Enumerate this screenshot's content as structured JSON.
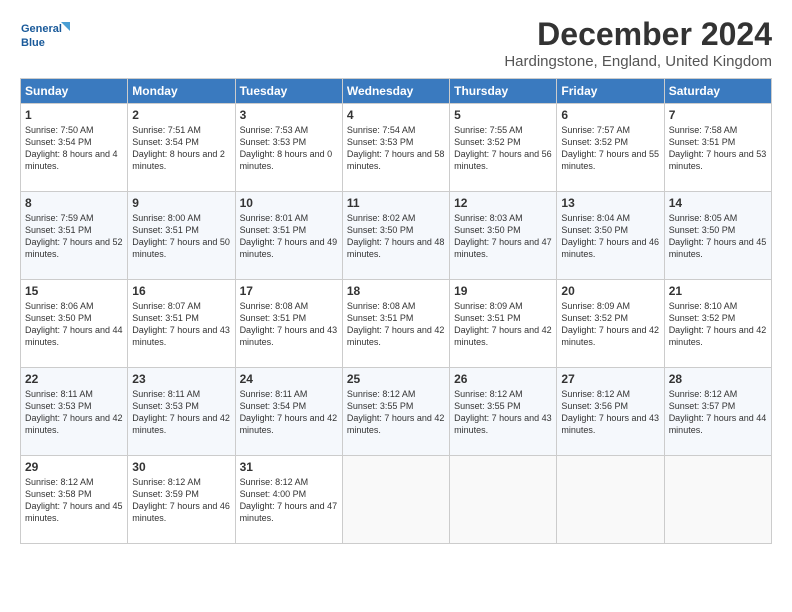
{
  "header": {
    "logo_line1": "General",
    "logo_line2": "Blue",
    "month": "December 2024",
    "location": "Hardingstone, England, United Kingdom"
  },
  "weekdays": [
    "Sunday",
    "Monday",
    "Tuesday",
    "Wednesday",
    "Thursday",
    "Friday",
    "Saturday"
  ],
  "weeks": [
    [
      {
        "day": "1",
        "sunrise": "7:50 AM",
        "sunset": "3:54 PM",
        "daylight": "8 hours and 4 minutes."
      },
      {
        "day": "2",
        "sunrise": "7:51 AM",
        "sunset": "3:54 PM",
        "daylight": "8 hours and 2 minutes."
      },
      {
        "day": "3",
        "sunrise": "7:53 AM",
        "sunset": "3:53 PM",
        "daylight": "8 hours and 0 minutes."
      },
      {
        "day": "4",
        "sunrise": "7:54 AM",
        "sunset": "3:53 PM",
        "daylight": "7 hours and 58 minutes."
      },
      {
        "day": "5",
        "sunrise": "7:55 AM",
        "sunset": "3:52 PM",
        "daylight": "7 hours and 56 minutes."
      },
      {
        "day": "6",
        "sunrise": "7:57 AM",
        "sunset": "3:52 PM",
        "daylight": "7 hours and 55 minutes."
      },
      {
        "day": "7",
        "sunrise": "7:58 AM",
        "sunset": "3:51 PM",
        "daylight": "7 hours and 53 minutes."
      }
    ],
    [
      {
        "day": "8",
        "sunrise": "7:59 AM",
        "sunset": "3:51 PM",
        "daylight": "7 hours and 52 minutes."
      },
      {
        "day": "9",
        "sunrise": "8:00 AM",
        "sunset": "3:51 PM",
        "daylight": "7 hours and 50 minutes."
      },
      {
        "day": "10",
        "sunrise": "8:01 AM",
        "sunset": "3:51 PM",
        "daylight": "7 hours and 49 minutes."
      },
      {
        "day": "11",
        "sunrise": "8:02 AM",
        "sunset": "3:50 PM",
        "daylight": "7 hours and 48 minutes."
      },
      {
        "day": "12",
        "sunrise": "8:03 AM",
        "sunset": "3:50 PM",
        "daylight": "7 hours and 47 minutes."
      },
      {
        "day": "13",
        "sunrise": "8:04 AM",
        "sunset": "3:50 PM",
        "daylight": "7 hours and 46 minutes."
      },
      {
        "day": "14",
        "sunrise": "8:05 AM",
        "sunset": "3:50 PM",
        "daylight": "7 hours and 45 minutes."
      }
    ],
    [
      {
        "day": "15",
        "sunrise": "8:06 AM",
        "sunset": "3:50 PM",
        "daylight": "7 hours and 44 minutes."
      },
      {
        "day": "16",
        "sunrise": "8:07 AM",
        "sunset": "3:51 PM",
        "daylight": "7 hours and 43 minutes."
      },
      {
        "day": "17",
        "sunrise": "8:08 AM",
        "sunset": "3:51 PM",
        "daylight": "7 hours and 43 minutes."
      },
      {
        "day": "18",
        "sunrise": "8:08 AM",
        "sunset": "3:51 PM",
        "daylight": "7 hours and 42 minutes."
      },
      {
        "day": "19",
        "sunrise": "8:09 AM",
        "sunset": "3:51 PM",
        "daylight": "7 hours and 42 minutes."
      },
      {
        "day": "20",
        "sunrise": "8:09 AM",
        "sunset": "3:52 PM",
        "daylight": "7 hours and 42 minutes."
      },
      {
        "day": "21",
        "sunrise": "8:10 AM",
        "sunset": "3:52 PM",
        "daylight": "7 hours and 42 minutes."
      }
    ],
    [
      {
        "day": "22",
        "sunrise": "8:11 AM",
        "sunset": "3:53 PM",
        "daylight": "7 hours and 42 minutes."
      },
      {
        "day": "23",
        "sunrise": "8:11 AM",
        "sunset": "3:53 PM",
        "daylight": "7 hours and 42 minutes."
      },
      {
        "day": "24",
        "sunrise": "8:11 AM",
        "sunset": "3:54 PM",
        "daylight": "7 hours and 42 minutes."
      },
      {
        "day": "25",
        "sunrise": "8:12 AM",
        "sunset": "3:55 PM",
        "daylight": "7 hours and 42 minutes."
      },
      {
        "day": "26",
        "sunrise": "8:12 AM",
        "sunset": "3:55 PM",
        "daylight": "7 hours and 43 minutes."
      },
      {
        "day": "27",
        "sunrise": "8:12 AM",
        "sunset": "3:56 PM",
        "daylight": "7 hours and 43 minutes."
      },
      {
        "day": "28",
        "sunrise": "8:12 AM",
        "sunset": "3:57 PM",
        "daylight": "7 hours and 44 minutes."
      }
    ],
    [
      {
        "day": "29",
        "sunrise": "8:12 AM",
        "sunset": "3:58 PM",
        "daylight": "7 hours and 45 minutes."
      },
      {
        "day": "30",
        "sunrise": "8:12 AM",
        "sunset": "3:59 PM",
        "daylight": "7 hours and 46 minutes."
      },
      {
        "day": "31",
        "sunrise": "8:12 AM",
        "sunset": "4:00 PM",
        "daylight": "7 hours and 47 minutes."
      },
      null,
      null,
      null,
      null
    ]
  ],
  "labels": {
    "sunrise": "Sunrise:",
    "sunset": "Sunset:",
    "daylight": "Daylight:"
  }
}
